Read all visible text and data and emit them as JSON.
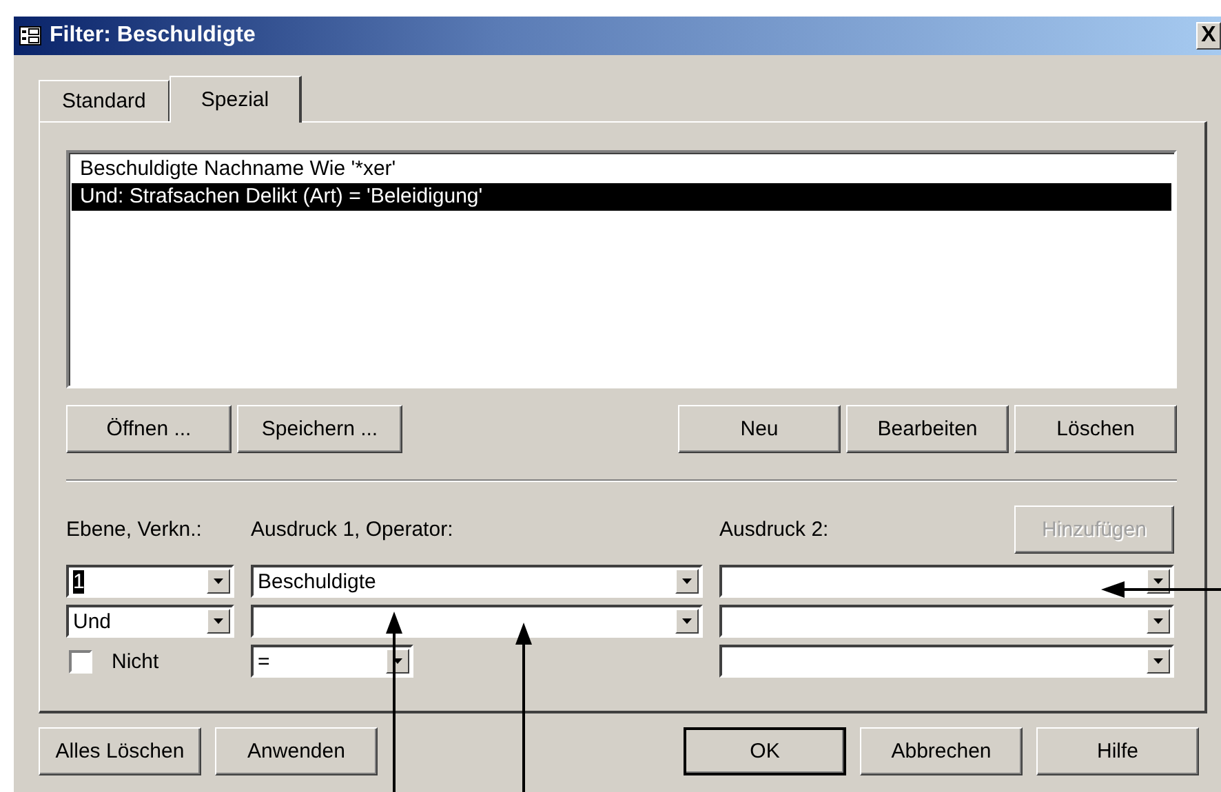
{
  "window": {
    "title": "Filter: Beschuldigte",
    "close_label": "X"
  },
  "tabs": [
    {
      "label": "Standard",
      "selected": false
    },
    {
      "label": "Spezial",
      "selected": true
    }
  ],
  "filter_list": [
    {
      "text": "Beschuldigte Nachname Wie '*xer'",
      "selected": false
    },
    {
      "text": "Und: Strafsachen Delikt (Art) = 'Beleidigung'",
      "selected": true
    }
  ],
  "list_buttons_left": [
    "Öffnen ...",
    "Speichern ..."
  ],
  "list_buttons_right": [
    "Neu",
    "Bearbeiten",
    "Löschen"
  ],
  "level_label": "Ebene, Verkn.:",
  "expression1_label": "Ausdruck 1, Operator:",
  "expression2_label": "Ausdruck 2:",
  "add_button": {
    "label": "Hinzufügen",
    "disabled": true
  },
  "level_column": [
    {
      "kind": "combo",
      "value": "1",
      "highlighted": true
    },
    {
      "kind": "combo",
      "value": "Und",
      "highlighted": false
    },
    {
      "kind": "checkbox",
      "label": "Nicht",
      "checked": false
    }
  ],
  "expression1_column": [
    {
      "kind": "combo",
      "value": "Beschuldigte"
    },
    {
      "kind": "combo"
    },
    {
      "kind": "operator",
      "value": "="
    }
  ],
  "expression2_column": [
    {
      "kind": "combo"
    },
    {
      "kind": "combo"
    },
    {
      "kind": "combo"
    }
  ],
  "bottom_left_buttons": [
    "Alles Löschen",
    "Anwenden"
  ],
  "bottom_right_buttons": [
    {
      "label": "OK",
      "default": true
    },
    {
      "label": "Abbrechen",
      "default": false
    },
    {
      "label": "Hilfe",
      "default": false
    }
  ]
}
